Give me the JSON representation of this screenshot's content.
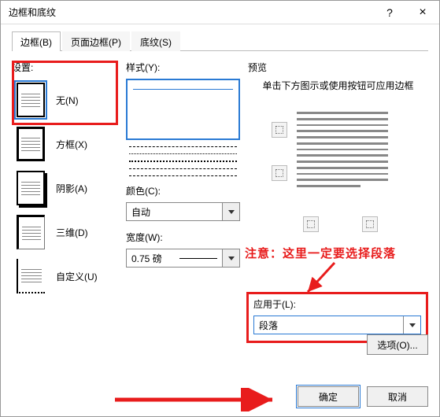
{
  "window": {
    "title": "边框和底纹",
    "help": "?",
    "close": "×"
  },
  "tabs": [
    "边框(B)",
    "页面边框(P)",
    "底纹(S)"
  ],
  "settings": {
    "label": "设置:",
    "items": [
      "无(N)",
      "方框(X)",
      "阴影(A)",
      "三维(D)",
      "自定义(U)"
    ]
  },
  "style": {
    "label": "样式(Y):"
  },
  "color": {
    "label": "颜色(C):",
    "value": "自动"
  },
  "width": {
    "label": "宽度(W):",
    "value": "0.75 磅"
  },
  "preview": {
    "label": "预览",
    "hint": "单击下方图示或使用按钮可应用边框"
  },
  "applyto": {
    "label": "应用于(L):",
    "value": "段落"
  },
  "buttons": {
    "options": "选项(O)...",
    "ok": "确定",
    "cancel": "取消"
  },
  "annotation": {
    "text": "注意：这里一定要选择段落",
    "color": "#e81c1c"
  }
}
